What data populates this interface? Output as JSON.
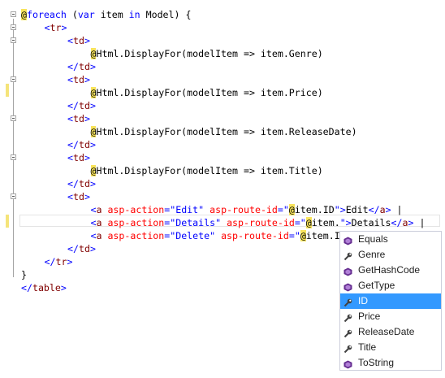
{
  "editor": {
    "lines": [
      {
        "indent": 0,
        "tokens": [
          {
            "c": "at",
            "t": "@"
          },
          {
            "c": "k",
            "t": "foreach"
          },
          {
            "c": "txt",
            "t": " ("
          },
          {
            "c": "k",
            "t": "var"
          },
          {
            "c": "txt",
            "t": " item "
          },
          {
            "c": "k",
            "t": "in"
          },
          {
            "c": "txt",
            "t": " Model) {"
          }
        ]
      },
      {
        "indent": 1,
        "tokens": [
          {
            "c": "s",
            "t": "<"
          },
          {
            "c": "t",
            "t": "tr"
          },
          {
            "c": "s",
            "t": ">"
          }
        ]
      },
      {
        "indent": 2,
        "tokens": [
          {
            "c": "s",
            "t": "<"
          },
          {
            "c": "t",
            "t": "td"
          },
          {
            "c": "s",
            "t": ">"
          }
        ]
      },
      {
        "indent": 3,
        "tokens": [
          {
            "c": "at",
            "t": "@"
          },
          {
            "c": "txt",
            "t": "Html.DisplayFor(modelItem => item.Genre)"
          }
        ]
      },
      {
        "indent": 2,
        "tokens": [
          {
            "c": "s",
            "t": "</"
          },
          {
            "c": "t",
            "t": "td"
          },
          {
            "c": "s",
            "t": ">"
          }
        ]
      },
      {
        "indent": 2,
        "tokens": [
          {
            "c": "s",
            "t": "<"
          },
          {
            "c": "t",
            "t": "td"
          },
          {
            "c": "s",
            "t": ">"
          }
        ]
      },
      {
        "indent": 3,
        "tokens": [
          {
            "c": "at",
            "t": "@"
          },
          {
            "c": "txt",
            "t": "Html.DisplayFor(modelItem => item.Price)"
          }
        ]
      },
      {
        "indent": 2,
        "tokens": [
          {
            "c": "s",
            "t": "</"
          },
          {
            "c": "t",
            "t": "td"
          },
          {
            "c": "s",
            "t": ">"
          }
        ]
      },
      {
        "indent": 2,
        "tokens": [
          {
            "c": "s",
            "t": "<"
          },
          {
            "c": "t",
            "t": "td"
          },
          {
            "c": "s",
            "t": ">"
          }
        ]
      },
      {
        "indent": 3,
        "tokens": [
          {
            "c": "at",
            "t": "@"
          },
          {
            "c": "txt",
            "t": "Html.DisplayFor(modelItem => item.ReleaseDate)"
          }
        ]
      },
      {
        "indent": 2,
        "tokens": [
          {
            "c": "s",
            "t": "</"
          },
          {
            "c": "t",
            "t": "td"
          },
          {
            "c": "s",
            "t": ">"
          }
        ]
      },
      {
        "indent": 2,
        "tokens": [
          {
            "c": "s",
            "t": "<"
          },
          {
            "c": "t",
            "t": "td"
          },
          {
            "c": "s",
            "t": ">"
          }
        ]
      },
      {
        "indent": 3,
        "tokens": [
          {
            "c": "at",
            "t": "@"
          },
          {
            "c": "txt",
            "t": "Html.DisplayFor(modelItem => item.Title)"
          }
        ]
      },
      {
        "indent": 2,
        "tokens": [
          {
            "c": "s",
            "t": "</"
          },
          {
            "c": "t",
            "t": "td"
          },
          {
            "c": "s",
            "t": ">"
          }
        ]
      },
      {
        "indent": 2,
        "tokens": [
          {
            "c": "s",
            "t": "<"
          },
          {
            "c": "t",
            "t": "td"
          },
          {
            "c": "s",
            "t": ">"
          }
        ]
      },
      {
        "indent": 3,
        "tokens": [
          {
            "c": "s",
            "t": "<"
          },
          {
            "c": "t",
            "t": "a"
          },
          {
            "c": "txt",
            "t": " "
          },
          {
            "c": "a",
            "t": "asp-action"
          },
          {
            "c": "s",
            "t": "=\"Edit\""
          },
          {
            "c": "txt",
            "t": " "
          },
          {
            "c": "a",
            "t": "asp-route-id"
          },
          {
            "c": "s",
            "t": "=\""
          },
          {
            "c": "at",
            "t": "@"
          },
          {
            "c": "txt",
            "t": "item.ID"
          },
          {
            "c": "s",
            "t": "\">"
          },
          {
            "c": "txt",
            "t": "Edit"
          },
          {
            "c": "s",
            "t": "</"
          },
          {
            "c": "t",
            "t": "a"
          },
          {
            "c": "s",
            "t": ">"
          },
          {
            "c": "txt",
            "t": " |"
          }
        ]
      },
      {
        "indent": 3,
        "tokens": [
          {
            "c": "s",
            "t": "<"
          },
          {
            "c": "t",
            "t": "a"
          },
          {
            "c": "txt",
            "t": " "
          },
          {
            "c": "a",
            "t": "asp-action"
          },
          {
            "c": "s",
            "t": "=\"Details\""
          },
          {
            "c": "txt",
            "t": " "
          },
          {
            "c": "a",
            "t": "asp-route-id"
          },
          {
            "c": "s",
            "t": "=\""
          },
          {
            "c": "at",
            "t": "@"
          },
          {
            "c": "txt",
            "t": "item."
          },
          {
            "c": "s",
            "t": "\">"
          },
          {
            "c": "txt",
            "t": "Details"
          },
          {
            "c": "s",
            "t": "</"
          },
          {
            "c": "t",
            "t": "a"
          },
          {
            "c": "s",
            "t": ">"
          },
          {
            "c": "txt",
            "t": " |"
          }
        ]
      },
      {
        "indent": 3,
        "tokens": [
          {
            "c": "s",
            "t": "<"
          },
          {
            "c": "t",
            "t": "a"
          },
          {
            "c": "txt",
            "t": " "
          },
          {
            "c": "a",
            "t": "asp-action"
          },
          {
            "c": "s",
            "t": "=\"Delete\""
          },
          {
            "c": "txt",
            "t": " "
          },
          {
            "c": "a",
            "t": "asp-route-id"
          },
          {
            "c": "s",
            "t": "=\""
          },
          {
            "c": "at",
            "t": "@"
          },
          {
            "c": "txt",
            "t": "item.I"
          }
        ]
      },
      {
        "indent": 2,
        "tokens": [
          {
            "c": "s",
            "t": "</"
          },
          {
            "c": "t",
            "t": "td"
          },
          {
            "c": "s",
            "t": ">"
          }
        ]
      },
      {
        "indent": 1,
        "tokens": [
          {
            "c": "s",
            "t": "</"
          },
          {
            "c": "t",
            "t": "tr"
          },
          {
            "c": "s",
            "t": ">"
          }
        ]
      },
      {
        "indent": 0,
        "tokens": [
          {
            "c": "txt",
            "t": "}"
          }
        ]
      },
      {
        "indent": 0,
        "tokens": [
          {
            "c": "s",
            "t": "</"
          },
          {
            "c": "t",
            "t": "table"
          },
          {
            "c": "s",
            "t": ">"
          }
        ]
      }
    ]
  },
  "completion": {
    "selected_index": 4,
    "items": [
      {
        "label": "Equals",
        "icon": "method-icon"
      },
      {
        "label": "Genre",
        "icon": "property-icon"
      },
      {
        "label": "GetHashCode",
        "icon": "method-icon"
      },
      {
        "label": "GetType",
        "icon": "method-icon"
      },
      {
        "label": "ID",
        "icon": "property-icon"
      },
      {
        "label": "Price",
        "icon": "property-icon"
      },
      {
        "label": "ReleaseDate",
        "icon": "property-icon"
      },
      {
        "label": "Title",
        "icon": "property-icon"
      },
      {
        "label": "ToString",
        "icon": "method-icon"
      }
    ]
  },
  "colors": {
    "keyword": "#0000ff",
    "tag": "#800000",
    "attribute": "#ff0000",
    "razor_highlight": "#f8e45c",
    "selection": "#3399ff",
    "method_icon": "#652d90"
  }
}
